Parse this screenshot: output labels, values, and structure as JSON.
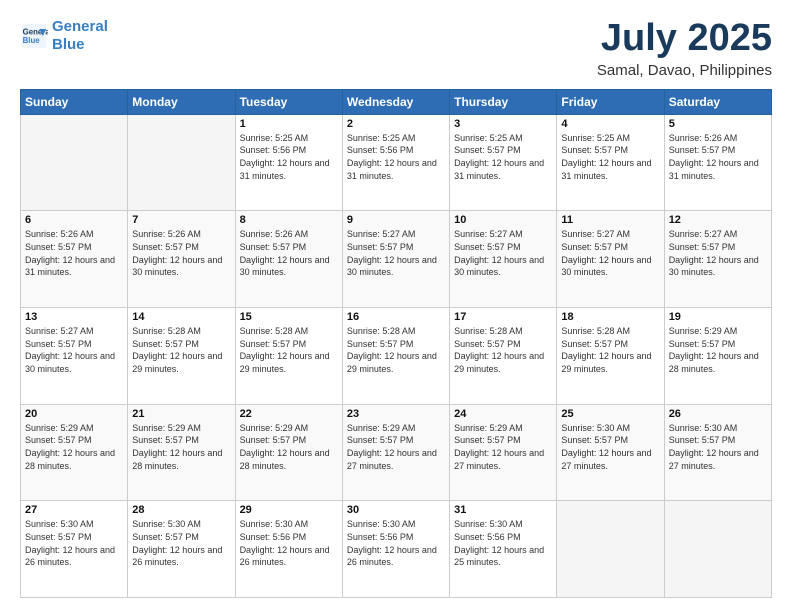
{
  "logo": {
    "line1": "General",
    "line2": "Blue"
  },
  "title": "July 2025",
  "subtitle": "Samal, Davao, Philippines",
  "weekdays": [
    "Sunday",
    "Monday",
    "Tuesday",
    "Wednesday",
    "Thursday",
    "Friday",
    "Saturday"
  ],
  "weeks": [
    [
      {
        "day": "",
        "info": ""
      },
      {
        "day": "",
        "info": ""
      },
      {
        "day": "1",
        "info": "Sunrise: 5:25 AM\nSunset: 5:56 PM\nDaylight: 12 hours and 31 minutes."
      },
      {
        "day": "2",
        "info": "Sunrise: 5:25 AM\nSunset: 5:56 PM\nDaylight: 12 hours and 31 minutes."
      },
      {
        "day": "3",
        "info": "Sunrise: 5:25 AM\nSunset: 5:57 PM\nDaylight: 12 hours and 31 minutes."
      },
      {
        "day": "4",
        "info": "Sunrise: 5:25 AM\nSunset: 5:57 PM\nDaylight: 12 hours and 31 minutes."
      },
      {
        "day": "5",
        "info": "Sunrise: 5:26 AM\nSunset: 5:57 PM\nDaylight: 12 hours and 31 minutes."
      }
    ],
    [
      {
        "day": "6",
        "info": "Sunrise: 5:26 AM\nSunset: 5:57 PM\nDaylight: 12 hours and 31 minutes."
      },
      {
        "day": "7",
        "info": "Sunrise: 5:26 AM\nSunset: 5:57 PM\nDaylight: 12 hours and 30 minutes."
      },
      {
        "day": "8",
        "info": "Sunrise: 5:26 AM\nSunset: 5:57 PM\nDaylight: 12 hours and 30 minutes."
      },
      {
        "day": "9",
        "info": "Sunrise: 5:27 AM\nSunset: 5:57 PM\nDaylight: 12 hours and 30 minutes."
      },
      {
        "day": "10",
        "info": "Sunrise: 5:27 AM\nSunset: 5:57 PM\nDaylight: 12 hours and 30 minutes."
      },
      {
        "day": "11",
        "info": "Sunrise: 5:27 AM\nSunset: 5:57 PM\nDaylight: 12 hours and 30 minutes."
      },
      {
        "day": "12",
        "info": "Sunrise: 5:27 AM\nSunset: 5:57 PM\nDaylight: 12 hours and 30 minutes."
      }
    ],
    [
      {
        "day": "13",
        "info": "Sunrise: 5:27 AM\nSunset: 5:57 PM\nDaylight: 12 hours and 30 minutes."
      },
      {
        "day": "14",
        "info": "Sunrise: 5:28 AM\nSunset: 5:57 PM\nDaylight: 12 hours and 29 minutes."
      },
      {
        "day": "15",
        "info": "Sunrise: 5:28 AM\nSunset: 5:57 PM\nDaylight: 12 hours and 29 minutes."
      },
      {
        "day": "16",
        "info": "Sunrise: 5:28 AM\nSunset: 5:57 PM\nDaylight: 12 hours and 29 minutes."
      },
      {
        "day": "17",
        "info": "Sunrise: 5:28 AM\nSunset: 5:57 PM\nDaylight: 12 hours and 29 minutes."
      },
      {
        "day": "18",
        "info": "Sunrise: 5:28 AM\nSunset: 5:57 PM\nDaylight: 12 hours and 29 minutes."
      },
      {
        "day": "19",
        "info": "Sunrise: 5:29 AM\nSunset: 5:57 PM\nDaylight: 12 hours and 28 minutes."
      }
    ],
    [
      {
        "day": "20",
        "info": "Sunrise: 5:29 AM\nSunset: 5:57 PM\nDaylight: 12 hours and 28 minutes."
      },
      {
        "day": "21",
        "info": "Sunrise: 5:29 AM\nSunset: 5:57 PM\nDaylight: 12 hours and 28 minutes."
      },
      {
        "day": "22",
        "info": "Sunrise: 5:29 AM\nSunset: 5:57 PM\nDaylight: 12 hours and 28 minutes."
      },
      {
        "day": "23",
        "info": "Sunrise: 5:29 AM\nSunset: 5:57 PM\nDaylight: 12 hours and 27 minutes."
      },
      {
        "day": "24",
        "info": "Sunrise: 5:29 AM\nSunset: 5:57 PM\nDaylight: 12 hours and 27 minutes."
      },
      {
        "day": "25",
        "info": "Sunrise: 5:30 AM\nSunset: 5:57 PM\nDaylight: 12 hours and 27 minutes."
      },
      {
        "day": "26",
        "info": "Sunrise: 5:30 AM\nSunset: 5:57 PM\nDaylight: 12 hours and 27 minutes."
      }
    ],
    [
      {
        "day": "27",
        "info": "Sunrise: 5:30 AM\nSunset: 5:57 PM\nDaylight: 12 hours and 26 minutes."
      },
      {
        "day": "28",
        "info": "Sunrise: 5:30 AM\nSunset: 5:57 PM\nDaylight: 12 hours and 26 minutes."
      },
      {
        "day": "29",
        "info": "Sunrise: 5:30 AM\nSunset: 5:56 PM\nDaylight: 12 hours and 26 minutes."
      },
      {
        "day": "30",
        "info": "Sunrise: 5:30 AM\nSunset: 5:56 PM\nDaylight: 12 hours and 26 minutes."
      },
      {
        "day": "31",
        "info": "Sunrise: 5:30 AM\nSunset: 5:56 PM\nDaylight: 12 hours and 25 minutes."
      },
      {
        "day": "",
        "info": ""
      },
      {
        "day": "",
        "info": ""
      }
    ]
  ]
}
